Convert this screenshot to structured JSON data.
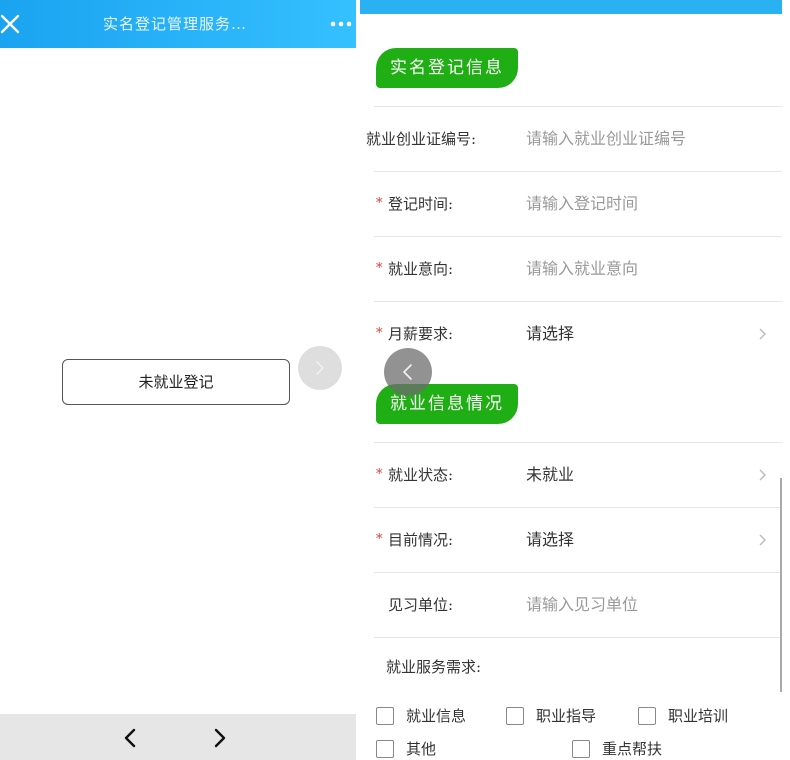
{
  "left_screen": {
    "title": "实名登记管理服务…",
    "main_button_label": "未就业登记",
    "top_bar_color": "#22aef4",
    "icons": {
      "close": "close-icon",
      "more": "more-dots-icon",
      "forward_circle": "forward-circle-icon",
      "nav_back": "chevron-left-icon",
      "nav_forward": "chevron-right-icon"
    }
  },
  "right_screen": {
    "section1_title": "实名登记信息",
    "section2_title": "就业信息情况",
    "accent_color": "#1fae14",
    "required_mark": "*",
    "fields": [
      {
        "label": "就业创业证编号:",
        "value": "请输入就业创业证编号",
        "required": false,
        "type": "input"
      },
      {
        "label": "登记时间:",
        "value": "请输入登记时间",
        "required": true,
        "type": "input"
      },
      {
        "label": "就业意向:",
        "value": "请输入就业意向",
        "required": true,
        "type": "input"
      },
      {
        "label": "月薪要求:",
        "value": "请选择",
        "required": true,
        "type": "select"
      }
    ],
    "fields2": [
      {
        "label": "就业状态:",
        "value": "未就业",
        "required": true,
        "type": "select"
      },
      {
        "label": "目前情况:",
        "value": "请选择",
        "required": true,
        "type": "select"
      },
      {
        "label": "见习单位:",
        "value": "请输入见习单位",
        "required": false,
        "type": "input"
      }
    ],
    "service_needs_label": "就业服务需求:",
    "service_needs_options": [
      "就业信息",
      "职业指导",
      "职业培训",
      "其他",
      "重点帮扶"
    ]
  }
}
